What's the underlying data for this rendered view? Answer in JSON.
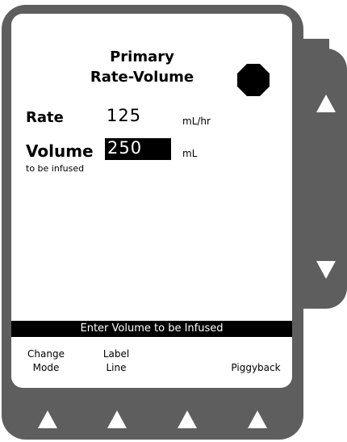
{
  "header": {
    "line1": "Primary",
    "line2": "Rate-Volume"
  },
  "icons": {
    "stop": "stop-octagon-icon",
    "up": "up-arrow-icon",
    "down": "down-arrow-icon",
    "softkey": "softkey-triangle-icon"
  },
  "rate": {
    "label": "Rate",
    "value": "125",
    "unit": "mL/hr"
  },
  "volume": {
    "label": "Volume",
    "value": "250",
    "unit": "mL",
    "sublabel": "to be infused"
  },
  "prompt": "Enter Volume to be Infused",
  "softkeys": [
    {
      "line1": "Change",
      "line2": "Mode"
    },
    {
      "line1": "Label",
      "line2": "Line"
    },
    {
      "line1": "",
      "line2": ""
    },
    {
      "line1": "",
      "line2": "Piggyback"
    }
  ],
  "colors": {
    "bezel": "#5e5e5e",
    "screen": "#ffffff",
    "ink": "#000000"
  }
}
